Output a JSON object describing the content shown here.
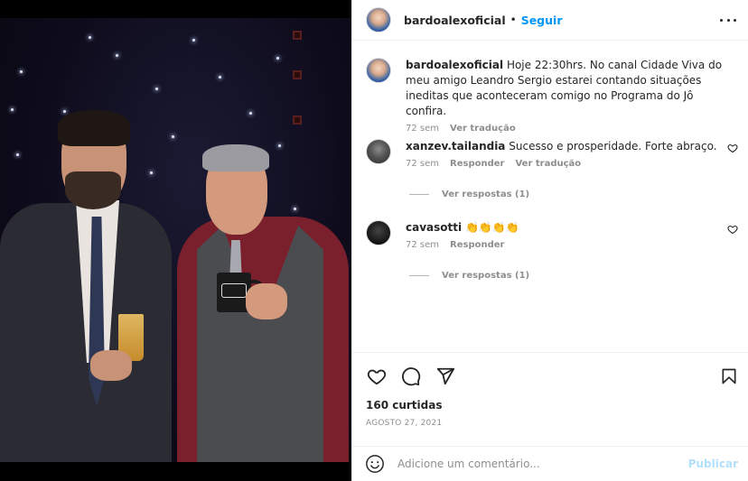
{
  "post": {
    "username": "bardoalexoficial",
    "separator": "•",
    "follow_label": "Seguir",
    "more_icon": "more-horizontal-icon"
  },
  "comments": [
    {
      "username": "bardoalexoficial",
      "text": "Hoje 22:30hrs. No canal Cidade Viva do meu amigo Leandro Sergio estarei contando situações ineditas que aconteceram comigo no Programa do Jô confira.",
      "time": "72 sem",
      "reply": "",
      "translate": "Ver tradução"
    },
    {
      "username": "xanzev.tailandia",
      "text": "Sucesso e prosperidade. Forte abraço.",
      "time": "72 sem",
      "reply": "Responder",
      "translate": "Ver tradução",
      "view_replies": "Ver respostas (1)"
    },
    {
      "username": "cavasotti",
      "text": "👏👏👏👏",
      "time": "72 sem",
      "reply": "Responder",
      "view_replies": "Ver respostas (1)"
    }
  ],
  "actions": {
    "like_icon": "heart-icon",
    "comment_icon": "comment-icon",
    "share_icon": "send-icon",
    "save_icon": "bookmark-icon"
  },
  "likes": "160 curtidas",
  "date": "AGOSTO 27, 2021",
  "add_comment": {
    "placeholder": "Adicione um comentário...",
    "publish_label": "Publicar",
    "emoji_icon": "emoji-icon"
  },
  "colors": {
    "link_blue": "#0095f6",
    "publish_disabled": "#b2dffc",
    "muted": "#8e8e8e",
    "text": "#262626"
  }
}
